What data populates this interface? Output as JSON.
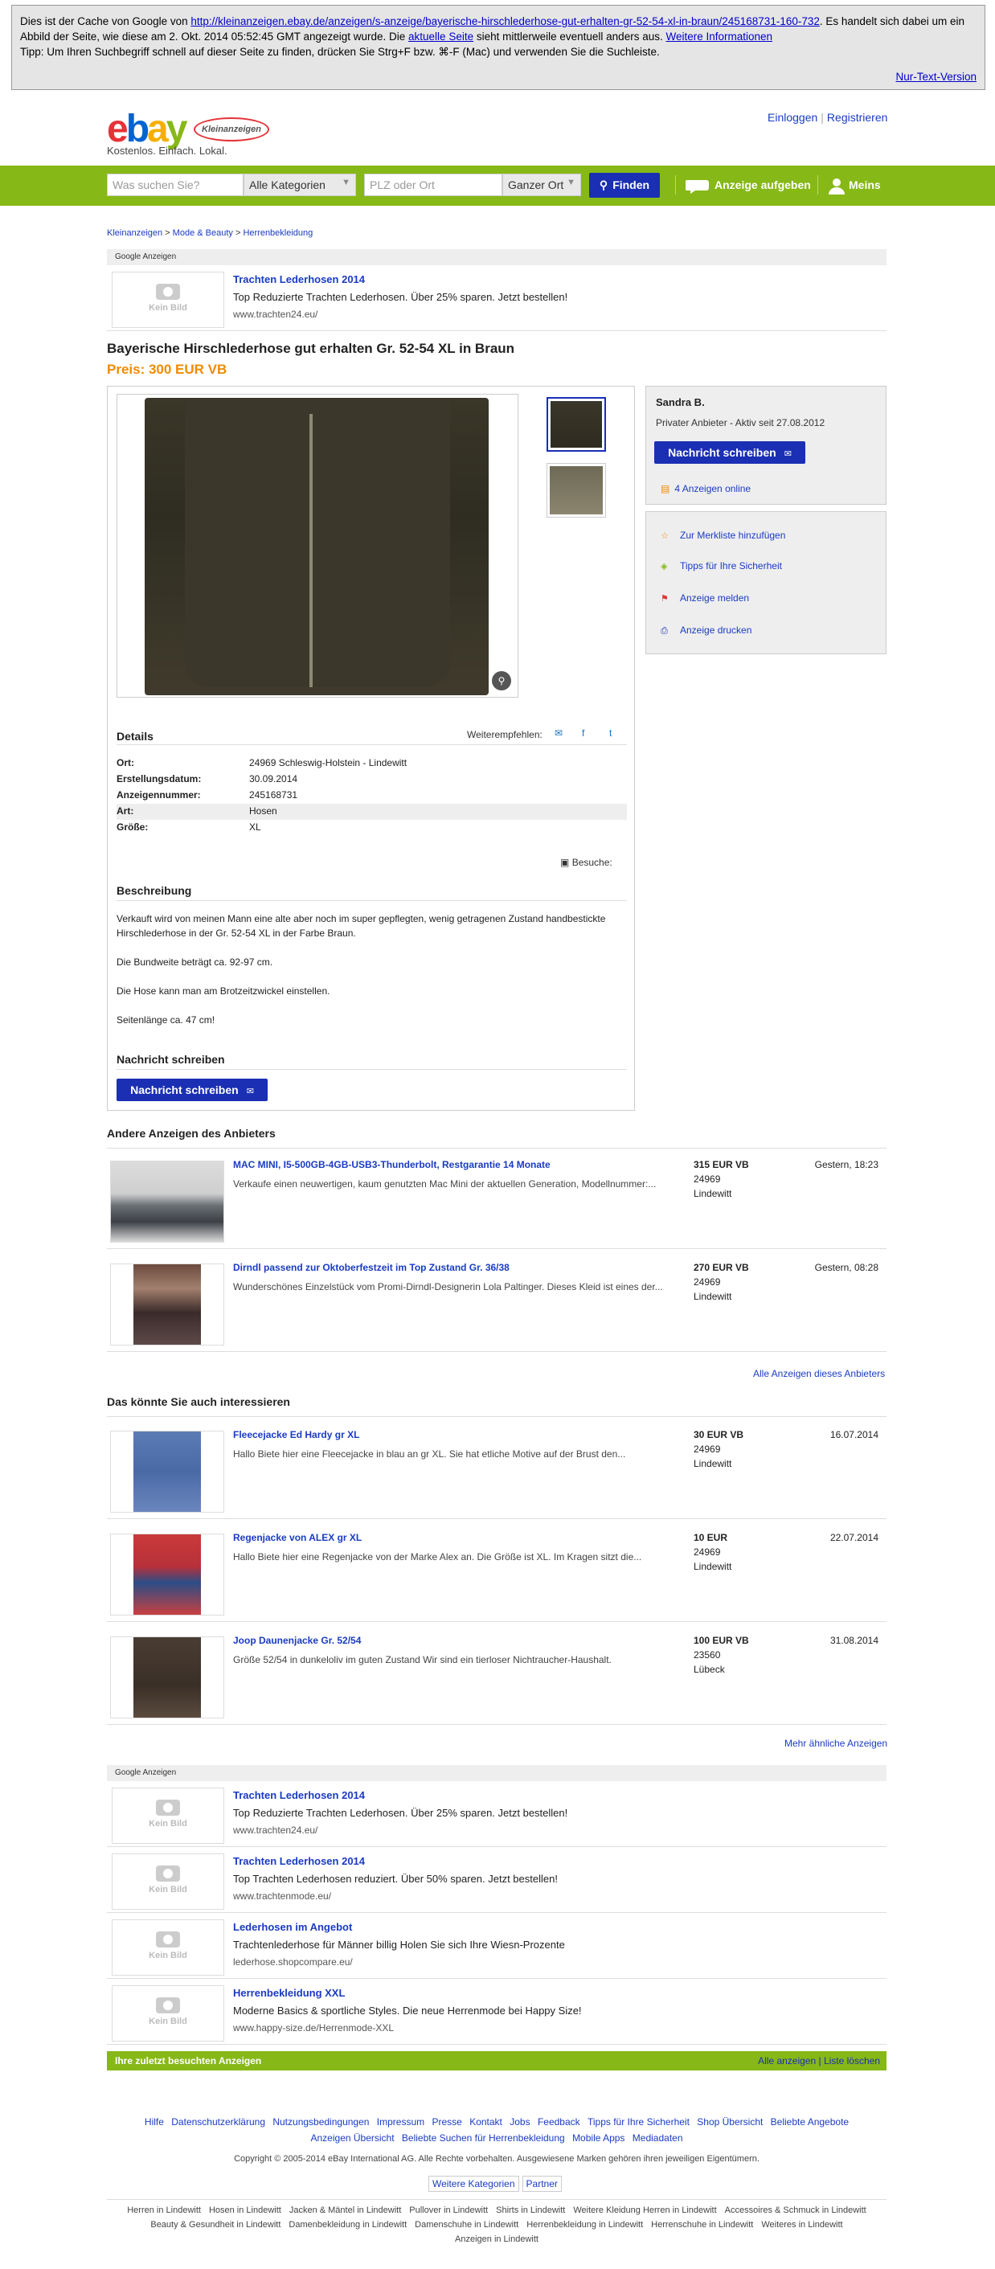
{
  "cache": {
    "line1_pre": "Dies ist der Cache von Google von ",
    "url": "http://kleinanzeigen.ebay.de/anzeigen/s-anzeige/bayerische-hirschlederhose-gut-erhalten-gr-52-54-xl-in-braun/245168731-160-732",
    "line1_post": ". Es handelt sich dabei um ein Abbild der Seite, wie diese am 2. Okt. 2014 05:52:45 GMT angezeigt wurde. Die ",
    "aktuelle": "aktuelle Seite",
    "line1_tail": " sieht mittlerweile eventuell anders aus. ",
    "weitere": "Weitere Informationen",
    "tip": "Tipp: Um Ihren Suchbegriff schnell auf dieser Seite zu finden, drücken Sie Strg+F bzw. ⌘-F (Mac) und verwenden Sie die Suchleiste.",
    "nur_text": "Nur-Text-Version"
  },
  "header": {
    "logo_letters": [
      "e",
      "b",
      "a",
      "y"
    ],
    "logo_badge": "Kleinanzeigen",
    "slogan": "Kostenlos. Einfach. Lokal.",
    "login": "Einloggen",
    "register": "Registrieren"
  },
  "search": {
    "query_placeholder": "Was suchen Sie?",
    "category": "Alle Kategorien",
    "location_placeholder": "PLZ oder Ort",
    "radius": "Ganzer Ort",
    "find": "Finden",
    "post_ad": "Anzeige aufgeben",
    "meins": "Meins"
  },
  "breadcrumb": [
    "Kleinanzeigen",
    "Mode & Beauty",
    "Herrenbekleidung"
  ],
  "google_ads_label": "Google Anzeigen",
  "kein_bild": "Kein Bild",
  "top_ad": {
    "title": "Trachten Lederhosen 2014",
    "desc": "Top Reduzierte Trachten Lederhosen. Über 25% sparen. Jetzt bestellen!",
    "url": "www.trachten24.eu/"
  },
  "listing": {
    "title": "Bayerische Hirschlederhose gut erhalten Gr. 52-54 XL in Braun",
    "price": "Preis: 300 EUR VB"
  },
  "seller": {
    "name": "Sandra B.",
    "info": "Privater Anbieter - Aktiv seit 27.08.2012",
    "contact_btn": "Nachricht schreiben",
    "online": "4 Anzeigen online"
  },
  "actions": [
    "Zur Merkliste hinzufügen",
    "Tipps für Ihre Sicherheit",
    "Anzeige melden",
    "Anzeige drucken"
  ],
  "details": {
    "heading": "Details",
    "weiterempfehlen": "Weiterempfehlen:",
    "rows": [
      {
        "k": "Ort:",
        "v": "24969 Schleswig-Holstein - Lindewitt"
      },
      {
        "k": "Erstellungsdatum:",
        "v": "30.09.2014"
      },
      {
        "k": "Anzeigennummer:",
        "v": "245168731"
      },
      {
        "k": "Art:",
        "v": "Hosen"
      },
      {
        "k": "Größe:",
        "v": "XL"
      }
    ],
    "besuche": "Besuche:"
  },
  "beschreibung": {
    "heading": "Beschreibung",
    "p1": "Verkauft wird von meinen Mann eine alte aber noch im super gepflegten, wenig getragenen Zustand handbestickte Hirschlederhose in der Gr. 52-54 XL in der Farbe Braun.",
    "p2": "Die Bundweite beträgt ca. 92-97 cm.",
    "p3": "Die Hose kann man am Brotzeitzwickel einstellen.",
    "p4": "Seitenlänge ca. 47 cm!"
  },
  "nachricht": {
    "heading": "Nachricht schreiben",
    "btn": "Nachricht schreiben"
  },
  "andere": {
    "heading": "Andere Anzeigen des Anbieters",
    "items": [
      {
        "title": "MAC MINI, I5-500GB-4GB-USB3-Thunderbolt, Restgarantie 14 Monate",
        "desc": "Verkaufe einen neuwertigen, kaum genutzten Mac Mini der aktuellen Generation, Modellnummer:...",
        "price": "315 EUR VB",
        "zip": "24969",
        "city": "Lindewitt",
        "date": "Gestern, 18:23"
      },
      {
        "title": "Dirndl passend zur Oktoberfestzeit im Top Zustand Gr. 36/38",
        "desc": "Wunderschönes Einzelstück vom Promi-Dirndl-Designerin Lola Paltinger. Dieses Kleid ist eines der...",
        "price": "270 EUR VB",
        "zip": "24969",
        "city": "Lindewitt",
        "date": "Gestern, 08:28"
      }
    ],
    "all_link": "Alle Anzeigen dieses Anbieters"
  },
  "interessant": {
    "heading": "Das könnte Sie auch interessieren",
    "items": [
      {
        "title": "Fleecejacke Ed Hardy gr XL",
        "desc": "Hallo Biete hier eine Fleecejacke in blau an gr XL. Sie hat etliche Motive auf der Brust den...",
        "price": "30 EUR VB",
        "zip": "24969",
        "city": "Lindewitt",
        "date": "16.07.2014"
      },
      {
        "title": "Regenjacke von ALEX gr XL",
        "desc": "Hallo Biete hier eine Regenjacke von der Marke Alex an. Die Größe ist XL. Im Kragen sitzt die...",
        "price": "10 EUR",
        "zip": "24969",
        "city": "Lindewitt",
        "date": "22.07.2014"
      },
      {
        "title": "Joop Daunenjacke Gr. 52/54",
        "desc": "Größe 52/54 in dunkeloliv im guten Zustand Wir sind ein tierloser Nichtraucher-Haushalt.",
        "price": "100 EUR VB",
        "zip": "23560",
        "city": "Lübeck",
        "date": "31.08.2014"
      }
    ],
    "more_link": "Mehr ähnliche Anzeigen"
  },
  "bottom_ads": [
    {
      "title": "Trachten Lederhosen 2014",
      "desc": "Top Reduzierte Trachten Lederhosen. Über 25% sparen. Jetzt bestellen!",
      "url": "www.trachten24.eu/"
    },
    {
      "title": "Trachten Lederhosen 2014",
      "desc": "Top Trachten Lederhosen reduziert. Über 50% sparen. Jetzt bestellen!",
      "url": "www.trachtenmode.eu/"
    },
    {
      "title": "Lederhosen im Angebot",
      "desc": "Trachtenlederhose für Männer billig Holen Sie sich Ihre Wiesn-Prozente",
      "url": "lederhose.shopcompare.eu/"
    },
    {
      "title": "Herrenbekleidung XXL",
      "desc": "Moderne Basics & sportliche Styles. Die neue Herrenmode bei Happy Size!",
      "url": "www.happy-size.de/Herrenmode-XXL"
    }
  ],
  "zuletzt": {
    "label": "Ihre zuletzt besuchten Anzeigen",
    "all": "Alle anzeigen",
    "clear": "Liste löschen"
  },
  "footer": {
    "links": [
      "Hilfe",
      "Datenschutzerklärung",
      "Nutzungsbedingungen",
      "Impressum",
      "Presse",
      "Kontakt",
      "Jobs",
      "Feedback",
      "Tipps für Ihre Sicherheit",
      "Shop Übersicht",
      "Beliebte Angebote",
      "Anzeigen Übersicht",
      "Beliebte Suchen für Herrenbekleidung",
      "Mobile Apps",
      "Mediadaten"
    ],
    "copyright": "Copyright © 2005-2014 eBay International AG. Alle Rechte vorbehalten. Ausgewiesene Marken gehören ihren jeweiligen Eigentümern.",
    "tabs": [
      "Weitere Kategorien",
      "Partner"
    ],
    "cities": [
      "Herren in Lindewitt",
      "Hosen in Lindewitt",
      "Jacken & Mäntel in Lindewitt",
      "Pullover in Lindewitt",
      "Shirts in Lindewitt",
      "Weitere Kleidung Herren in Lindewitt",
      "Accessoires & Schmuck in Lindewitt",
      "Beauty & Gesundheit in Lindewitt",
      "Damenbekleidung in Lindewitt",
      "Damenschuhe in Lindewitt",
      "Herrenbekleidung in Lindewitt",
      "Herrenschuhe in Lindewitt",
      "Weiteres in Lindewitt",
      "Anzeigen in Lindewitt"
    ]
  }
}
